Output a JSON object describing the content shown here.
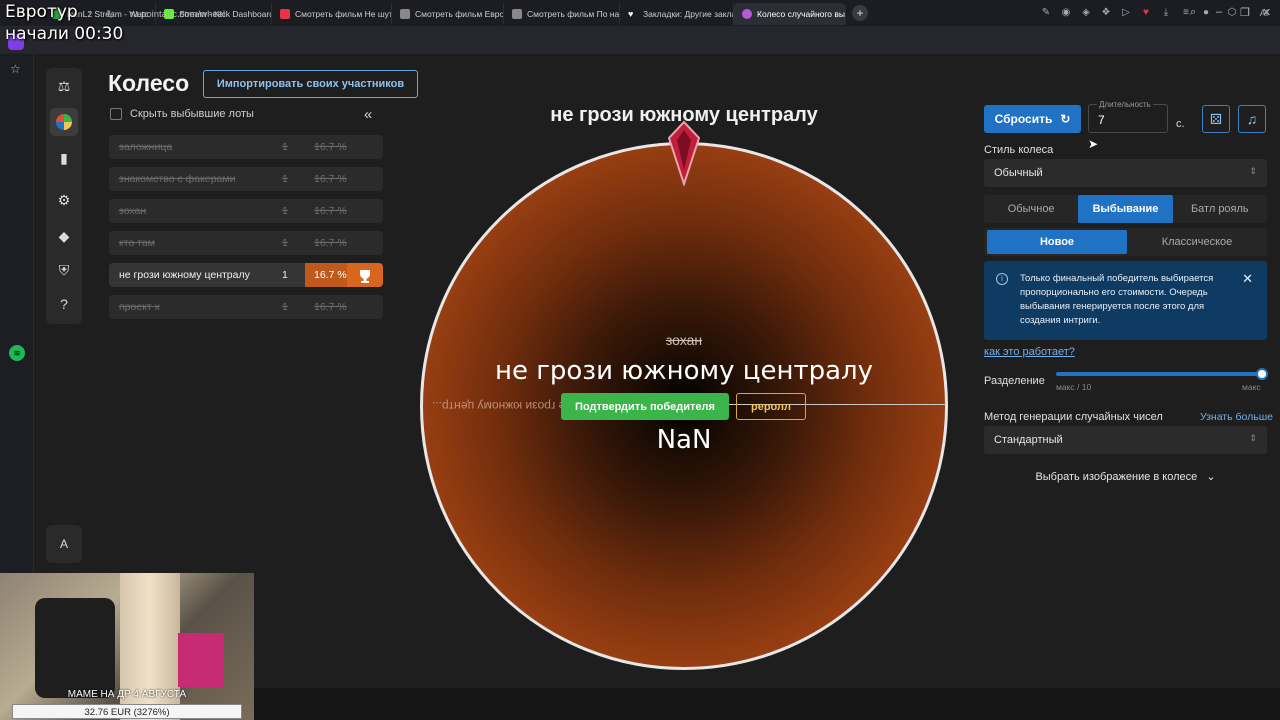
{
  "browser": {
    "tabs": [
      {
        "label": "iconL2 Stream - Watc",
        "color": "#2ea043"
      },
      {
        "label": "Stream - Kick Dashboard",
        "color": "#53fc18"
      },
      {
        "label": "Смотреть фильм Не шут",
        "color": "#e8334a"
      },
      {
        "label": "Смотреть фильм Евроту",
        "color": "#888888"
      },
      {
        "label": "Смотреть фильм По нак",
        "color": "#888888"
      },
      {
        "label": "Закладки: Другие заклад",
        "color": "#ffffff"
      },
      {
        "label": "Колесо случайного выб",
        "color": "#b65bd6"
      }
    ],
    "url": "ru.pointauc.com/wheel"
  },
  "overlay": {
    "line1": "Евротур",
    "line2": "начали 00:30"
  },
  "page": {
    "title": "Колесо",
    "import_button": "Импортировать своих участников",
    "hide_checkbox_label": "Скрыть выбывшие лоты",
    "collapse_icon": "«"
  },
  "lots": [
    {
      "name": "заложница",
      "qty": "1",
      "pct": "16.7 %",
      "out": true
    },
    {
      "name": "знакомство с факерами",
      "qty": "1",
      "pct": "16.7 %",
      "out": true
    },
    {
      "name": "зохан",
      "qty": "1",
      "pct": "16.7 %",
      "out": true
    },
    {
      "name": "кто там",
      "qty": "1",
      "pct": "16.7 %",
      "out": true
    },
    {
      "name": "не грози южному централу",
      "qty": "1",
      "pct": "16.7 %",
      "out": false
    },
    {
      "name": "проект х",
      "qty": "1",
      "pct": "16.7 %",
      "out": true
    }
  ],
  "wheel": {
    "top_title": "не грози южному централу",
    "segment_label": "не грози южному центр...",
    "eliminated": "зохан",
    "winner": "не грози южному централу",
    "confirm_button": "Подтвердить победителя",
    "reroll_button": "реролл",
    "amount": "NaN"
  },
  "settings": {
    "reset_button": "Сбросить",
    "duration_label": "Длительность",
    "duration_value": "7",
    "duration_unit": "с.",
    "style_label": "Стиль колеса",
    "style_value": "Обычный",
    "mode_tabs": [
      "Обычное",
      "Выбывание",
      "Батл рояль"
    ],
    "mode_active": 1,
    "variant_tabs": [
      "Новое",
      "Классическое"
    ],
    "variant_active": 0,
    "info_text": "Только финальный победитель выбирается пропорционально его стоимости. Очередь выбывания генерируется после этого для создания интриги.",
    "how_link": "как это работает?",
    "split_label": "Разделение",
    "split_min_caption": "макс / 10",
    "split_max_caption": "макс",
    "split_fraction": 1.0,
    "rng_label": "Метод генерации случайных чисел",
    "rng_more_link": "Узнать больше",
    "rng_value": "Стандартный",
    "image_picker": "Выбрать изображение в колесе"
  },
  "webcam": {
    "caption": "МАМЕ НА ДР 4 АВГУСТА",
    "amount": "32.76 EUR (3276%)"
  },
  "colors": {
    "accent": "#1f72c4",
    "winner_badge": "#d9661e",
    "confirm": "#3bb54a",
    "reroll": "#d9a93c",
    "wheel": "#a44514"
  }
}
